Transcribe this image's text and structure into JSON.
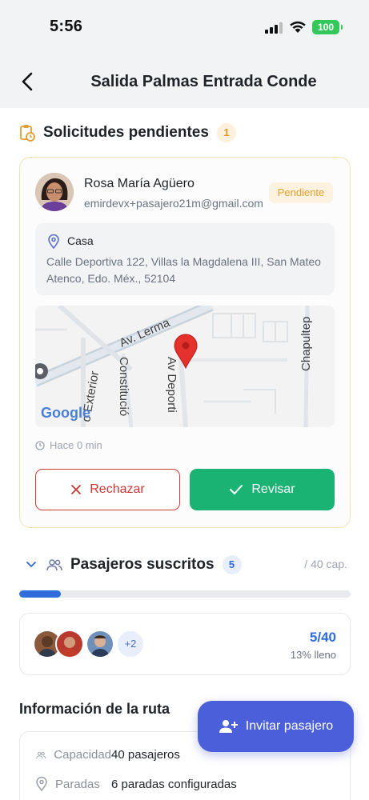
{
  "status_bar": {
    "time": "5:56",
    "battery": "100"
  },
  "nav": {
    "title": "Salida Palmas Entrada Conde"
  },
  "pending": {
    "title": "Solicitudes pendientes",
    "count": "1",
    "request": {
      "name": "Rosa María Agüero",
      "email": "emirdevx+pasajero21m@gmail.com",
      "status": "Pendiente",
      "address_label": "Casa",
      "address": "Calle Deportiva 122, Villas la Magdalena III, San Mateo Atenco, Edo. Méx., 52104",
      "map_labels": [
        "Av. Lerma",
        "Av Deporti",
        "Constitució",
        "o Exterior",
        "Chapultep"
      ],
      "map_logo": "Google",
      "elapsed": "Hace 0 min",
      "reject_label": "Rechazar",
      "review_label": "Revisar"
    }
  },
  "passengers": {
    "title": "Pasajeros suscritos",
    "count": "5",
    "capacity_label": "/ 40 cap.",
    "fill_fraction": 0.125,
    "more": "+2",
    "ratio": "5/40",
    "percent_label": "13% lleno"
  },
  "route_info": {
    "title": "Información de la ruta",
    "rows": [
      {
        "key": "Capacidad",
        "value": "40 pasajeros",
        "icon": "people-icon"
      },
      {
        "key": "Paradas",
        "value": "6 paradas configuradas",
        "icon": "pin-icon"
      }
    ]
  },
  "fab": {
    "label": "Invitar pasajero",
    "icon": "add-user-icon"
  },
  "colors": {
    "accent_blue": "#2e6ddb",
    "fab": "#4a5fd9",
    "success": "#1bb374",
    "danger": "#c93535",
    "pending_bg": "#fdf2df",
    "pending_text": "#e0a030"
  }
}
